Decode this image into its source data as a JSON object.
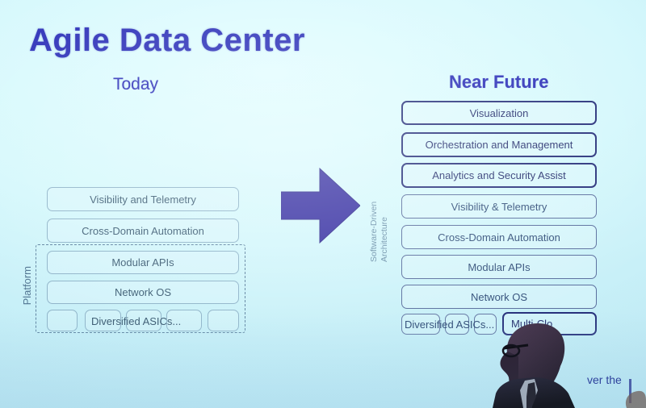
{
  "slide": {
    "title": "Agile Data Center",
    "title_color": "#2b2fb8",
    "background_color": "#cdf2f9",
    "partial_text": "ver the"
  },
  "today": {
    "heading": "Today",
    "group_label": "Platform",
    "layers": [
      {
        "label": "Visibility and Telemetry",
        "emphasis": "normal"
      },
      {
        "label": "Cross-Domain Automation",
        "emphasis": "normal"
      },
      {
        "label": "Modular APIs",
        "emphasis": "normal"
      },
      {
        "label": "Network OS",
        "emphasis": "normal"
      }
    ],
    "asic_row": {
      "label": "Diversified ASICs...",
      "chip_count": 5
    }
  },
  "near_future": {
    "heading": "Near Future",
    "side_label_line1": "Software-Driven",
    "side_label_line2": "Architecture",
    "layers": [
      {
        "label": "Visualization",
        "emphasis": "strong"
      },
      {
        "label": "Orchestration and Management",
        "emphasis": "strong"
      },
      {
        "label": "Analytics and Security Assist",
        "emphasis": "strong"
      },
      {
        "label": "Visibility & Telemetry",
        "emphasis": "normal"
      },
      {
        "label": "Cross-Domain Automation",
        "emphasis": "normal"
      },
      {
        "label": "Modular APIs",
        "emphasis": "normal"
      },
      {
        "label": "Network OS",
        "emphasis": "normal"
      }
    ],
    "asic_row": {
      "label": "Diversified ASICs...",
      "chip_count": 3
    },
    "multi_cloud": {
      "label": "Multi-Clo",
      "emphasis": "strong"
    }
  },
  "arrow": {
    "direction": "right",
    "color": "#3730a3"
  }
}
